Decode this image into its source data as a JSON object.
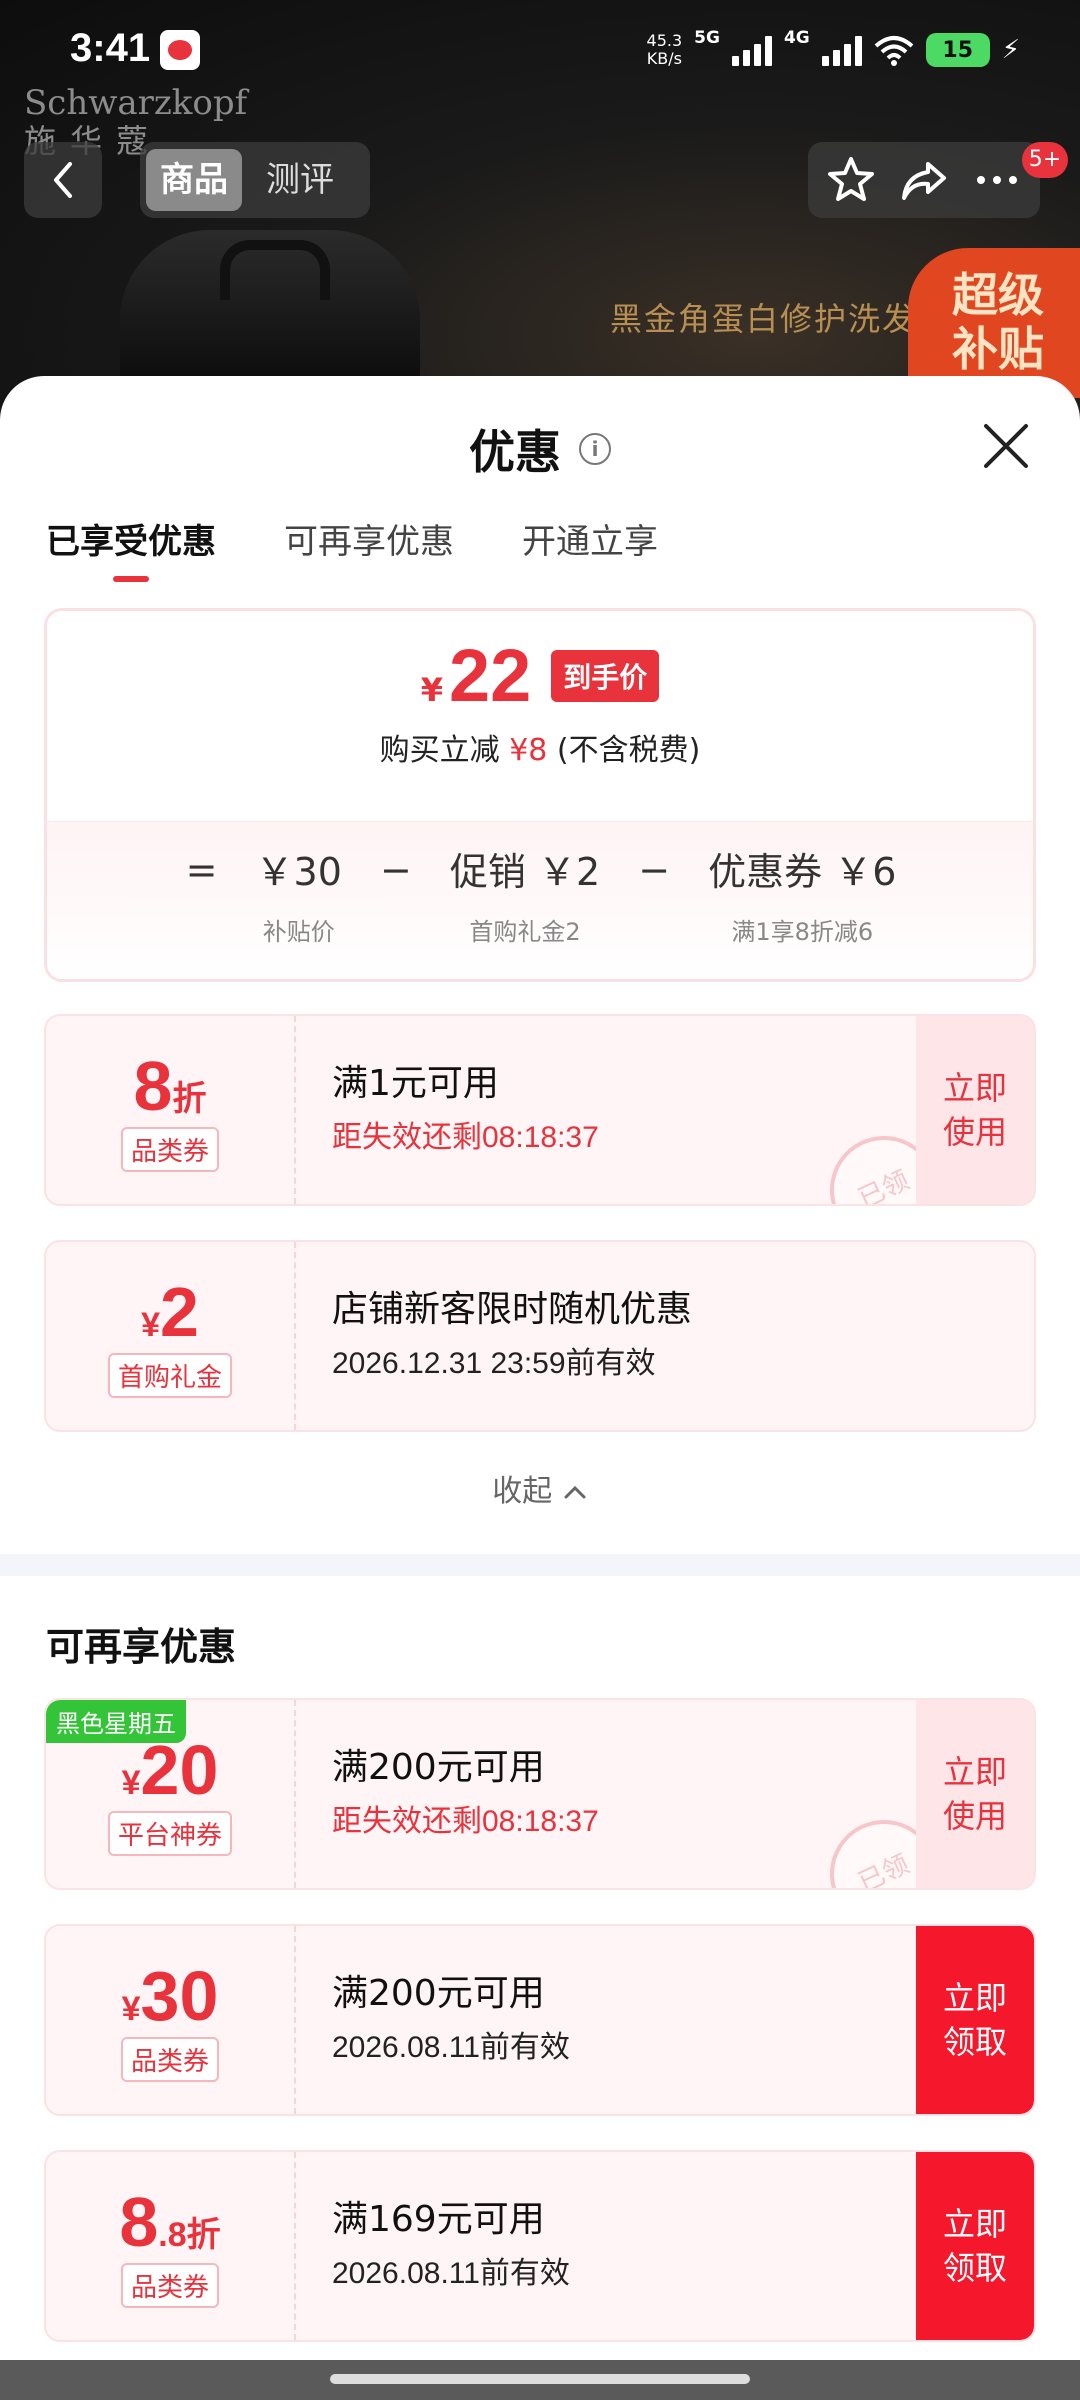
{
  "status": {
    "time": "3:41",
    "net_speed_top": "45.3",
    "net_speed_bottom": "KB/s",
    "sig1": "5G",
    "sig2": "4G",
    "battery": "15"
  },
  "header": {
    "brand_en": "Schwarzkopf",
    "brand_cn": "施华蔻",
    "tabs": [
      "商品",
      "测评"
    ],
    "badge": "5+",
    "banner_text": "黑金角蛋白修护洗发",
    "super_badge": [
      "超级",
      "补贴"
    ]
  },
  "sheet": {
    "title": "优惠",
    "tabs": [
      "已享受优惠",
      "可再享优惠",
      "开通立享"
    ]
  },
  "price": {
    "yen": "¥",
    "amount": "22",
    "tag": "到手价",
    "sub_prefix": "购买立减",
    "sub_amount": "¥8",
    "sub_suffix": "(不含税费)",
    "formula": [
      {
        "value": "￥30",
        "label": "补贴价"
      },
      {
        "value": "促销 ￥2",
        "label": "首购礼金2"
      },
      {
        "value": "优惠券 ￥6",
        "label": "满1享8折减6"
      }
    ],
    "eq": "=",
    "minus": "−"
  },
  "used_coupons": [
    {
      "prefix": "",
      "amount": "8",
      "suffix": "折",
      "type": "品类券",
      "condition": "满1元可用",
      "expire": "距失效还剩08:18:37",
      "action": "立即使用",
      "stamp": "已领"
    },
    {
      "prefix": "¥",
      "amount": "2",
      "suffix": "",
      "type": "首购礼金",
      "condition": "店铺新客限时随机优惠",
      "expire": "2026.12.31 23:59前有效"
    }
  ],
  "collapse_label": "收起",
  "more_section_title": "可再享优惠",
  "more_coupons": [
    {
      "tag": "黑色星期五",
      "prefix": "¥",
      "amount": "20",
      "suffix": "",
      "type": "平台神券",
      "condition": "满200元可用",
      "expire": "距失效还剩08:18:37",
      "action": "立即使用",
      "stamp": "已领"
    },
    {
      "prefix": "¥",
      "amount": "30",
      "suffix": "",
      "type": "品类券",
      "condition": "满200元可用",
      "expire": "2026.08.11前有效",
      "action": "立即领取"
    },
    {
      "prefix": "",
      "amount": "8",
      "suffix": ".8折",
      "type": "品类券",
      "condition": "满169元可用",
      "expire": "2026.08.11前有效",
      "action": "立即领取"
    }
  ],
  "colors": {
    "accent": "#e8323c",
    "action_red": "#f5182d",
    "green_tag": "#33c437"
  }
}
